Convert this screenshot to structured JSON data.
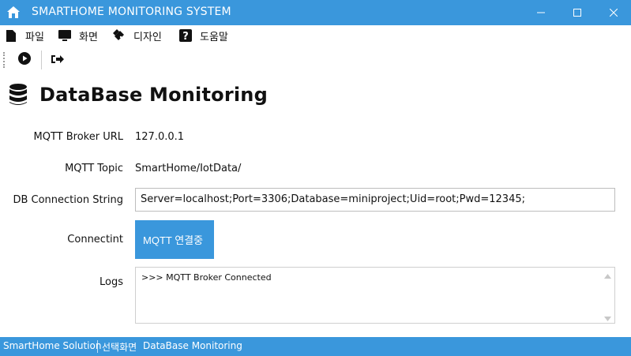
{
  "window": {
    "title": "SMARTHOME MONITORING SYSTEM",
    "accent_color": "#3a97dc"
  },
  "menu": [
    {
      "label": "파일",
      "icon": "file-icon"
    },
    {
      "label": "화면",
      "icon": "monitor-icon"
    },
    {
      "label": "디자인",
      "icon": "palette-icon"
    },
    {
      "label": "도움말",
      "icon": "help-icon"
    }
  ],
  "toolbar": {
    "items": [
      {
        "icon": "play-circle-icon"
      },
      {
        "icon": "exit-icon"
      }
    ]
  },
  "page": {
    "title": "DataBase Monitoring",
    "icon": "database-icon"
  },
  "form": {
    "broker_url_label": "MQTT Broker URL",
    "broker_url_value": "127.0.0.1",
    "topic_label": "MQTT Topic",
    "topic_value": "SmartHome/IotData/",
    "db_conn_label": "DB Connection String",
    "db_conn_value": "Server=localhost;Port=3306;Database=miniproject;Uid=root;Pwd=12345;",
    "connect_label": "Connectint",
    "connect_button": "MQTT 연결중",
    "logs_label": "Logs",
    "logs_text": ">>> MQTT Broker Connected"
  },
  "status": {
    "solution": "SmartHome Solution",
    "selected_screen_label": "선택화면",
    "selected_screen_value": "DataBase Monitoring"
  }
}
